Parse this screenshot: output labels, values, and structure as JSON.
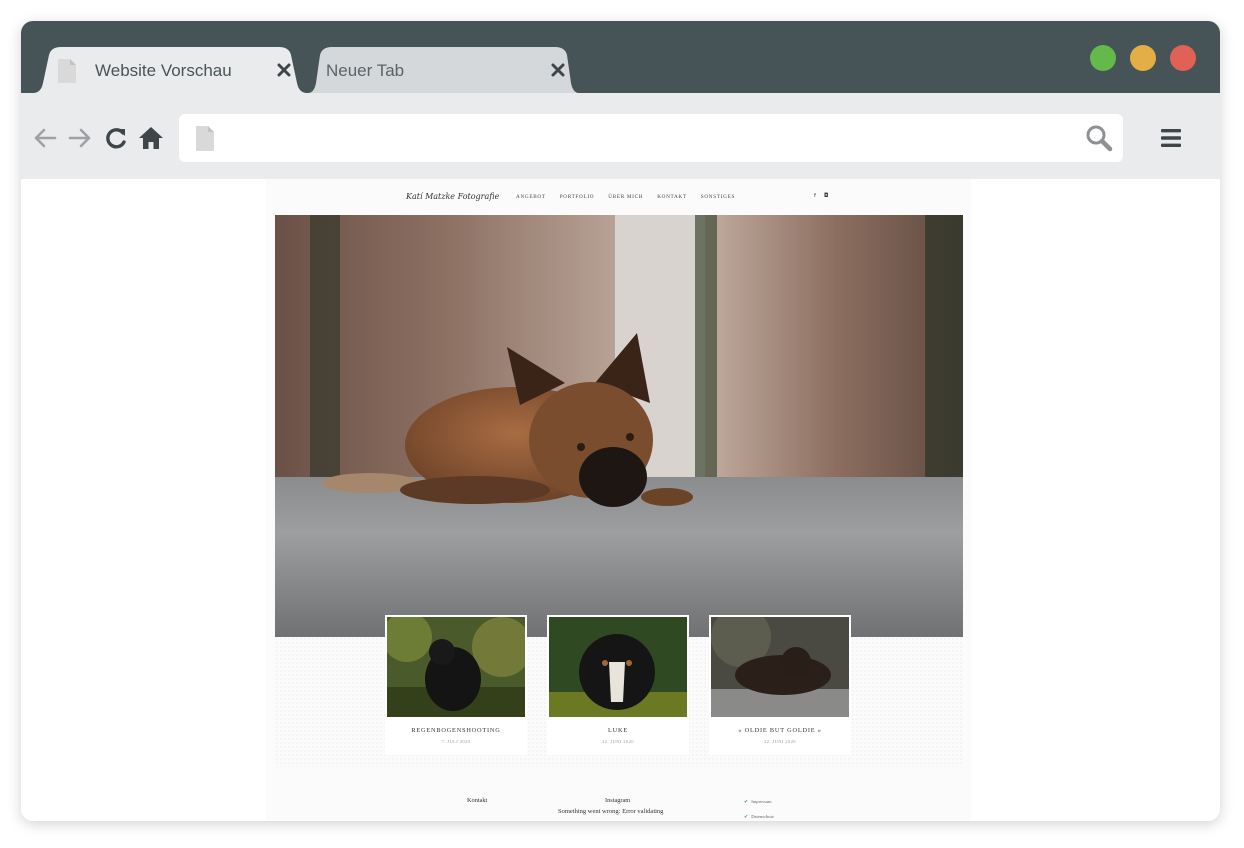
{
  "browser": {
    "tabs": [
      {
        "label": "Website Vorschau",
        "active": true
      },
      {
        "label": "Neuer Tab",
        "active": false
      }
    ],
    "url": "",
    "window_controls": [
      "green-light",
      "yellow-light",
      "red-light"
    ],
    "colors": {
      "tabstrip": "#465357",
      "toolbar": "#e9ebed",
      "active_tab": "#e9ebed",
      "inactive_tab": "#d5d8db",
      "light_green": "#63b94a",
      "light_yellow": "#e2ae45",
      "light_red": "#e06155"
    }
  },
  "site": {
    "logo": "Katí Matzke Fotografie",
    "nav": [
      "ANGEBOT",
      "PORTFOLIO",
      "ÜBER MICH",
      "KONTAKT",
      "SONSTIGES"
    ],
    "social": [
      "facebook-icon",
      "instagram-icon"
    ],
    "posts": [
      {
        "title": "REGENBOGENSHOOTING",
        "date": "7. JULI 2020"
      },
      {
        "title": "LUKE",
        "date": "22. JUNI 2020"
      },
      {
        "title": "« OLDIE BUT GOLDIE »",
        "date": "22. JUNI 2020"
      }
    ],
    "footer": {
      "kontakt": "Kontakt",
      "instagram": "Instagram",
      "instagram_error": "Something went wrong: Error validating",
      "links": [
        "Impressum",
        "Datenschutz"
      ]
    }
  }
}
